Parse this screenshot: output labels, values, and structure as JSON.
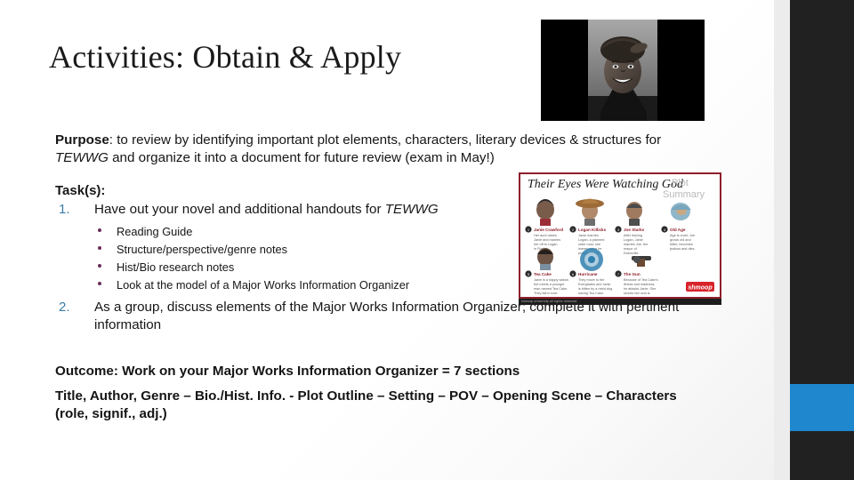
{
  "slide": {
    "title": "Activities: Obtain & Apply",
    "purpose": {
      "label": "Purpose",
      "text_1": ": to review by identifying important plot elements, characters, literary devices & structures for ",
      "italic_1": "TEWWG",
      "text_2": " and organize it into a document for future review (exam in May!)"
    },
    "tasks": {
      "heading": "Task(s):",
      "items": [
        {
          "number": "1.",
          "text_1": "Have out your novel and additional handouts for ",
          "italic_1": "TEWWG",
          "subitems": [
            "Reading Guide",
            "Structure/perspective/genre notes",
            "Hist/Bio research notes",
            "Look at the model of a Major Works Information Organizer"
          ]
        },
        {
          "number": "2.",
          "text_1": "As a group, discuss elements of the Major Works Information Organizer; complete it with pertinent information",
          "italic_1": "",
          "subitems": []
        }
      ]
    },
    "outcome": {
      "line1": "Outcome: Work on your Major Works Information Organizer = 7 sections",
      "line2": "Title, Author, Genre – Bio./Hist. Info. - Plot Outline – Setting – POV – Opening Scene – Characters (role, signif., adj.)"
    },
    "photo": {
      "alt": "black-and-white portrait of a smiling woman wearing a hat"
    },
    "infographic": {
      "title_script": "Their Eyes Were Watching God",
      "title_sub_line1": "Plot",
      "title_sub_line2": "Summary",
      "logo": "shmoop",
      "characters": [
        {
          "n": "1",
          "name": "Janie Crawford"
        },
        {
          "n": "2",
          "name": "Logan Killicks"
        },
        {
          "n": "3",
          "name": "Joe Starks"
        },
        {
          "n": "4",
          "name": "Old Age"
        },
        {
          "n": "5",
          "name": "Tea Cake"
        },
        {
          "n": "6",
          "name": "Hurricane"
        },
        {
          "n": "7",
          "name": "The Gun"
        }
      ],
      "footer_strip": "shmoop university all rights reserved"
    },
    "colors": {
      "accent_blue": "#1f87ce",
      "list_number_blue": "#3a7ca5",
      "bullet_plum": "#6b2d5c",
      "bar_dark": "#212121",
      "frame_red": "#8e1f2a",
      "logo_red": "#d8232a"
    }
  }
}
